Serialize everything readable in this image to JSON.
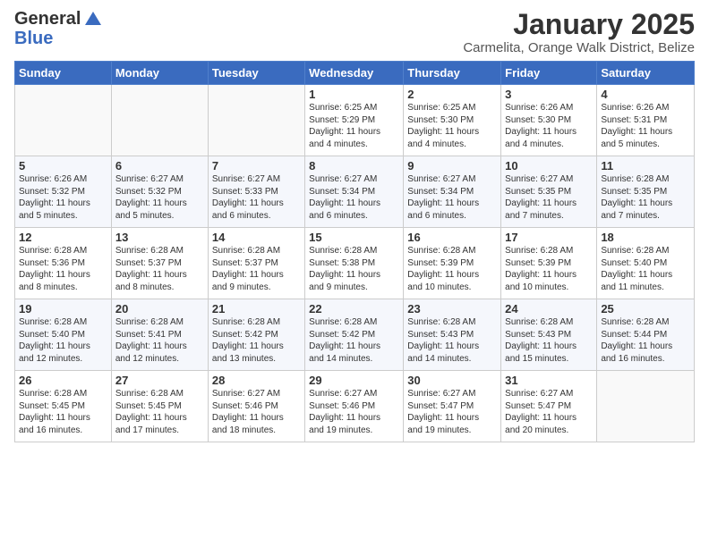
{
  "header": {
    "logo_general": "General",
    "logo_blue": "Blue",
    "title": "January 2025",
    "subtitle": "Carmelita, Orange Walk District, Belize"
  },
  "days_of_week": [
    "Sunday",
    "Monday",
    "Tuesday",
    "Wednesday",
    "Thursday",
    "Friday",
    "Saturday"
  ],
  "weeks": [
    [
      {
        "day": "",
        "info": ""
      },
      {
        "day": "",
        "info": ""
      },
      {
        "day": "",
        "info": ""
      },
      {
        "day": "1",
        "info": "Sunrise: 6:25 AM\nSunset: 5:29 PM\nDaylight: 11 hours\nand 4 minutes."
      },
      {
        "day": "2",
        "info": "Sunrise: 6:25 AM\nSunset: 5:30 PM\nDaylight: 11 hours\nand 4 minutes."
      },
      {
        "day": "3",
        "info": "Sunrise: 6:26 AM\nSunset: 5:30 PM\nDaylight: 11 hours\nand 4 minutes."
      },
      {
        "day": "4",
        "info": "Sunrise: 6:26 AM\nSunset: 5:31 PM\nDaylight: 11 hours\nand 5 minutes."
      }
    ],
    [
      {
        "day": "5",
        "info": "Sunrise: 6:26 AM\nSunset: 5:32 PM\nDaylight: 11 hours\nand 5 minutes."
      },
      {
        "day": "6",
        "info": "Sunrise: 6:27 AM\nSunset: 5:32 PM\nDaylight: 11 hours\nand 5 minutes."
      },
      {
        "day": "7",
        "info": "Sunrise: 6:27 AM\nSunset: 5:33 PM\nDaylight: 11 hours\nand 6 minutes."
      },
      {
        "day": "8",
        "info": "Sunrise: 6:27 AM\nSunset: 5:34 PM\nDaylight: 11 hours\nand 6 minutes."
      },
      {
        "day": "9",
        "info": "Sunrise: 6:27 AM\nSunset: 5:34 PM\nDaylight: 11 hours\nand 6 minutes."
      },
      {
        "day": "10",
        "info": "Sunrise: 6:27 AM\nSunset: 5:35 PM\nDaylight: 11 hours\nand 7 minutes."
      },
      {
        "day": "11",
        "info": "Sunrise: 6:28 AM\nSunset: 5:35 PM\nDaylight: 11 hours\nand 7 minutes."
      }
    ],
    [
      {
        "day": "12",
        "info": "Sunrise: 6:28 AM\nSunset: 5:36 PM\nDaylight: 11 hours\nand 8 minutes."
      },
      {
        "day": "13",
        "info": "Sunrise: 6:28 AM\nSunset: 5:37 PM\nDaylight: 11 hours\nand 8 minutes."
      },
      {
        "day": "14",
        "info": "Sunrise: 6:28 AM\nSunset: 5:37 PM\nDaylight: 11 hours\nand 9 minutes."
      },
      {
        "day": "15",
        "info": "Sunrise: 6:28 AM\nSunset: 5:38 PM\nDaylight: 11 hours\nand 9 minutes."
      },
      {
        "day": "16",
        "info": "Sunrise: 6:28 AM\nSunset: 5:39 PM\nDaylight: 11 hours\nand 10 minutes."
      },
      {
        "day": "17",
        "info": "Sunrise: 6:28 AM\nSunset: 5:39 PM\nDaylight: 11 hours\nand 10 minutes."
      },
      {
        "day": "18",
        "info": "Sunrise: 6:28 AM\nSunset: 5:40 PM\nDaylight: 11 hours\nand 11 minutes."
      }
    ],
    [
      {
        "day": "19",
        "info": "Sunrise: 6:28 AM\nSunset: 5:40 PM\nDaylight: 11 hours\nand 12 minutes."
      },
      {
        "day": "20",
        "info": "Sunrise: 6:28 AM\nSunset: 5:41 PM\nDaylight: 11 hours\nand 12 minutes."
      },
      {
        "day": "21",
        "info": "Sunrise: 6:28 AM\nSunset: 5:42 PM\nDaylight: 11 hours\nand 13 minutes."
      },
      {
        "day": "22",
        "info": "Sunrise: 6:28 AM\nSunset: 5:42 PM\nDaylight: 11 hours\nand 14 minutes."
      },
      {
        "day": "23",
        "info": "Sunrise: 6:28 AM\nSunset: 5:43 PM\nDaylight: 11 hours\nand 14 minutes."
      },
      {
        "day": "24",
        "info": "Sunrise: 6:28 AM\nSunset: 5:43 PM\nDaylight: 11 hours\nand 15 minutes."
      },
      {
        "day": "25",
        "info": "Sunrise: 6:28 AM\nSunset: 5:44 PM\nDaylight: 11 hours\nand 16 minutes."
      }
    ],
    [
      {
        "day": "26",
        "info": "Sunrise: 6:28 AM\nSunset: 5:45 PM\nDaylight: 11 hours\nand 16 minutes."
      },
      {
        "day": "27",
        "info": "Sunrise: 6:28 AM\nSunset: 5:45 PM\nDaylight: 11 hours\nand 17 minutes."
      },
      {
        "day": "28",
        "info": "Sunrise: 6:27 AM\nSunset: 5:46 PM\nDaylight: 11 hours\nand 18 minutes."
      },
      {
        "day": "29",
        "info": "Sunrise: 6:27 AM\nSunset: 5:46 PM\nDaylight: 11 hours\nand 19 minutes."
      },
      {
        "day": "30",
        "info": "Sunrise: 6:27 AM\nSunset: 5:47 PM\nDaylight: 11 hours\nand 19 minutes."
      },
      {
        "day": "31",
        "info": "Sunrise: 6:27 AM\nSunset: 5:47 PM\nDaylight: 11 hours\nand 20 minutes."
      },
      {
        "day": "",
        "info": ""
      }
    ]
  ]
}
